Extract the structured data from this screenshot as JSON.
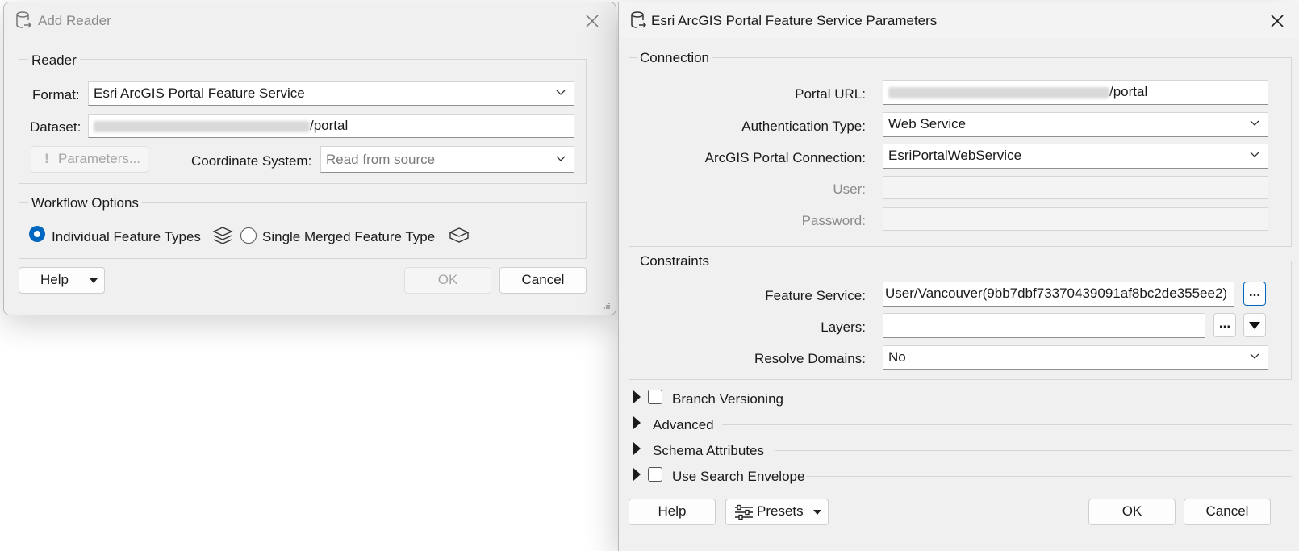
{
  "add_reader": {
    "title": "Add Reader",
    "reader_group": "Reader",
    "format_label": "Format:",
    "format_value": "Esri ArcGIS Portal Feature Service",
    "dataset_label": "Dataset:",
    "dataset_suffix": "/portal",
    "parameters_button": "Parameters...",
    "coord_label": "Coordinate System:",
    "coord_value": "Read from source",
    "workflow_group": "Workflow Options",
    "radio_individual": "Individual Feature Types",
    "radio_merged": "Single Merged Feature Type",
    "help_button": "Help",
    "ok_button": "OK",
    "cancel_button": "Cancel"
  },
  "params": {
    "title": "Esri ArcGIS Portal Feature Service Parameters",
    "connection_group": "Connection",
    "portal_url_label": "Portal URL:",
    "portal_url_suffix": "/portal",
    "auth_type_label": "Authentication Type:",
    "auth_type_value": "Web Service",
    "portal_conn_label": "ArcGIS Portal Connection:",
    "portal_conn_value": "EsriPortalWebService",
    "user_label": "User:",
    "password_label": "Password:",
    "constraints_group": "Constraints",
    "feature_service_label": "Feature Service:",
    "feature_service_value": "User/Vancouver(9bb7dbf73370439091af8bc2de355ee2)",
    "ellipsis": "...",
    "layers_label": "Layers:",
    "resolve_domains_label": "Resolve Domains:",
    "resolve_domains_value": "No",
    "sections": [
      "Branch Versioning",
      "Advanced",
      "Schema Attributes",
      "Use Search Envelope"
    ],
    "help_button": "Help",
    "presets_button": "Presets",
    "ok_button": "OK",
    "cancel_button": "Cancel"
  }
}
